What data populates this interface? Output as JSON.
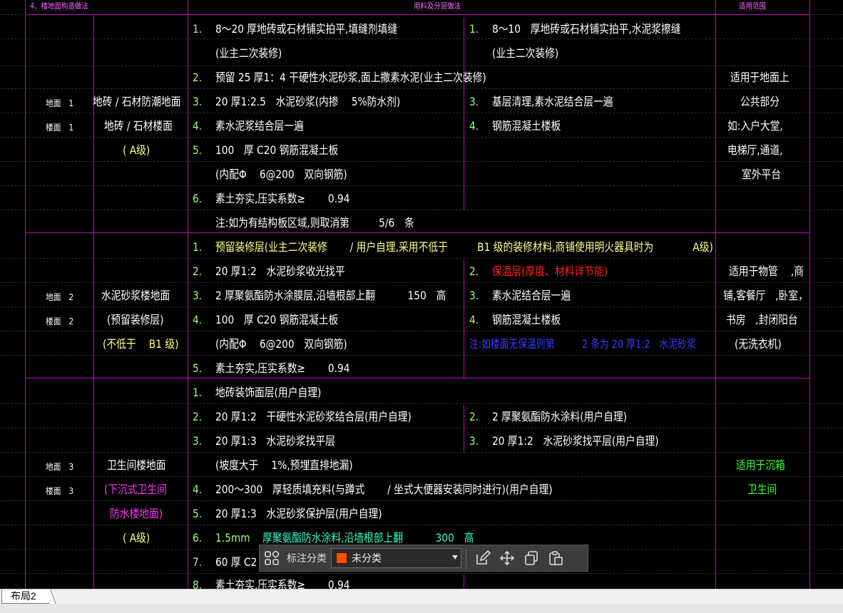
{
  "header": {
    "section": "4、楼地面构造做法",
    "materials": "用料及分层做法",
    "scope": "适用范围"
  },
  "rows": [
    {
      "codes": [
        "地面　1",
        "楼面　1"
      ],
      "name": [
        "地砖 / 石材防潮地面",
        "地砖 / 石材楼面",
        "( A级)"
      ],
      "left_lines": [
        {
          "num": "1.",
          "text": "8～20 厚地砖或石材铺实拍平,填缝剂填缝"
        },
        {
          "num": "",
          "text": "(业主二次装修)"
        },
        {
          "num": "2.",
          "text": "预留 25 厚1：4 干硬性水泥砂浆,面上撒素水泥(业主二次装修)"
        },
        {
          "num": "3.",
          "text": "20 厚1:2.5　水泥砂浆(内掺　 5%防水剂)"
        },
        {
          "num": "4.",
          "text": "素水泥浆结合层一遍"
        },
        {
          "num": "5.",
          "text": "100　厚 C20 钢筋混凝土板"
        },
        {
          "num": "",
          "text": "(内配Φ　 6@200　双向钢筋)"
        },
        {
          "num": "6.",
          "text": "素土夯实,压实系数≥　　 0.94"
        },
        {
          "num": "",
          "text": "注:如为有结构板区域,则取消第　　　5/6　条"
        }
      ],
      "right_lines": [
        {
          "num": "1.",
          "text": "8～10　厚地砖或石材铺实拍平,水泥浆擦缝"
        },
        {
          "num": "",
          "text": "(业主二次装修)"
        },
        {
          "num": "3.",
          "text": "基层清理,素水泥结合层一遍"
        },
        {
          "num": "4.",
          "text": "钢筋混凝土楼板"
        }
      ],
      "scope": [
        "适用于地面上",
        "公共部分",
        "如:入户大堂,",
        "电梯厅,通道,",
        "室外平台"
      ]
    },
    {
      "codes": [
        "地面　2",
        "楼面　2"
      ],
      "name": [
        "水泥砂浆楼地面",
        "(预留装修层)",
        "(不低于　 B1 级)"
      ],
      "left_lines": [
        {
          "num": "1.",
          "text": "预留装修层(业主二次装修　　 / 用户自理,采用不低于　　　B1 级的装修材料,商铺使用明火器具时为　　　　A级)"
        },
        {
          "num": "2.",
          "text": "20 厚1:2　水泥砂浆收光找平"
        },
        {
          "num": "3.",
          "text": "2 厚聚氨酯防水涂膜层,沿墙根部上翻　　　 150　高"
        },
        {
          "num": "4.",
          "text": "100　厚 C20 钢筋混凝土板"
        },
        {
          "num": "",
          "text": "(内配Φ　 6@200　双向钢筋)"
        },
        {
          "num": "5.",
          "text": "素土夯实,压实系数≥　　 0.94"
        }
      ],
      "right_lines": [
        {
          "num": "2.",
          "text": "保温层(厚度、材料详节能)"
        },
        {
          "num": "3.",
          "text": "素水泥结合层一遍"
        },
        {
          "num": "4.",
          "text": "钢筋混凝土楼板"
        },
        {
          "num": "",
          "text": "注:如楼面无保温则第　　　2 条为 20 厚1:2　水泥砂浆"
        }
      ],
      "scope": [
        "适用于物管　 ,商",
        "铺,客餐厅　,卧室，",
        "书房　,封闭阳台",
        "(无洗衣机)"
      ]
    },
    {
      "codes": [
        "地面　3",
        "楼面　3"
      ],
      "name": [
        "卫生间楼地面",
        "(下沉式卫生间",
        "防水楼地面)",
        "( A级)"
      ],
      "left_lines": [
        {
          "num": "1.",
          "text": "地砖装饰面层(用户自理)"
        },
        {
          "num": "2.",
          "text": "20 厚1:2　干硬性水泥砂浆结合层(用户自理)"
        },
        {
          "num": "3.",
          "text": "20 厚1:3　水泥砂浆找平层"
        },
        {
          "num": "",
          "text": "(坡度大于　 1%,预埋直排地漏)"
        },
        {
          "num": "4.",
          "text": "200～300　厚轻质填充料(与蹲式　　 / 坐式大便器安装同时进行)(用户自理)"
        },
        {
          "num": "5.",
          "text": "20 厚1:3　水泥砂浆保护层(用户自理)"
        },
        {
          "num": "6.",
          "text": "1.5mm",
          "extra": "厚聚氨酯防水涂料,沿墙根部上翻　　　 300　高"
        },
        {
          "num": "7.",
          "text": "60 厚 C2"
        },
        {
          "num": "8.",
          "text": "素土夯实,压实系数≥　　 0.94"
        }
      ],
      "right_lines": [
        {
          "num": "2.",
          "text": "2 厚聚氨酯防水涂料(用户自理)"
        },
        {
          "num": "3.",
          "text": "20 厚1:2　水泥砂浆找平层(用户自理)"
        }
      ],
      "scope": [
        "适用于沉箱",
        "卫生间"
      ]
    }
  ],
  "toolbar": {
    "label": "标注分类",
    "selected": "未分类",
    "swatch_color": "#ff4d00",
    "icons": [
      "grid-apps-icon",
      "edit-icon",
      "move-icon",
      "copy-icon",
      "paste-icon"
    ]
  },
  "tabs": {
    "active": "布局2"
  }
}
